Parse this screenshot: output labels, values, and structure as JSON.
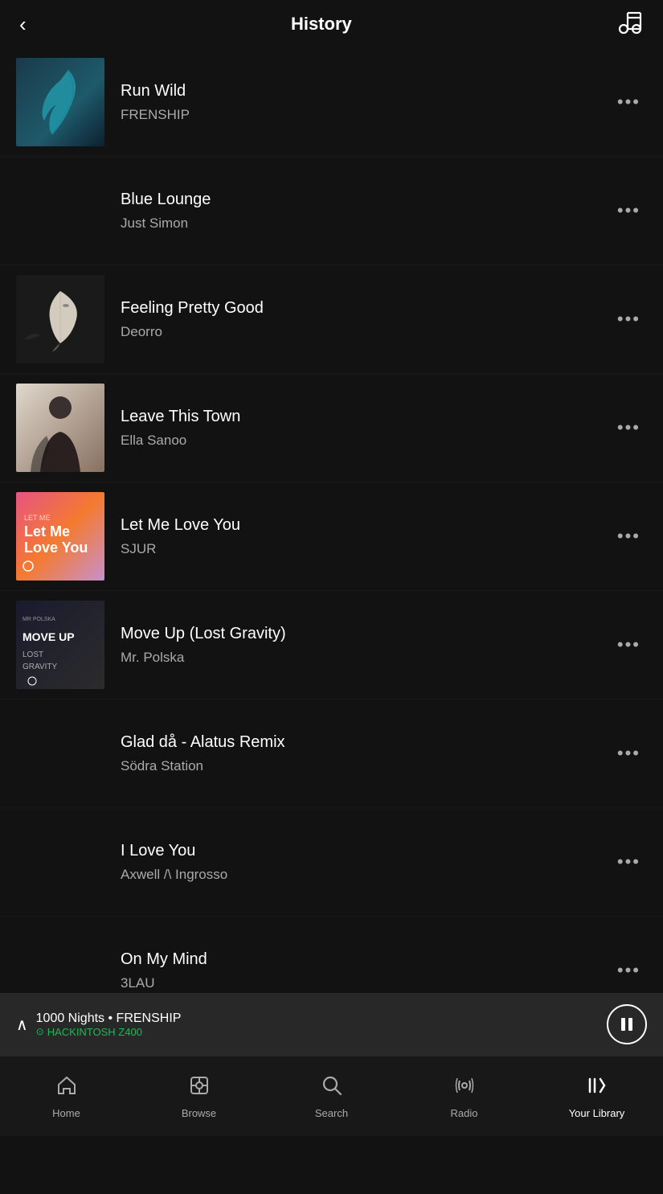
{
  "header": {
    "back_label": "‹",
    "title": "History",
    "music_icon": "♩"
  },
  "tracks": [
    {
      "id": "run-wild",
      "name": "Run Wild",
      "artist": "FRENSHIP",
      "art_class": "art-run-wild",
      "art_type": "feather"
    },
    {
      "id": "blue-lounge",
      "name": "Blue Lounge",
      "artist": "Just Simon",
      "art_class": "art-blue-lounge",
      "art_type": "gradient"
    },
    {
      "id": "feeling-pretty-good",
      "name": "Feeling Pretty Good",
      "artist": "Deorro",
      "art_class": "art-feeling-pretty-good",
      "art_type": "bird"
    },
    {
      "id": "leave-this-town",
      "name": "Leave This Town",
      "artist": "Ella Sanoo",
      "art_class": "art-leave-this-town",
      "art_type": "person"
    },
    {
      "id": "let-me-love-you",
      "name": "Let Me Love You",
      "artist": "SJUR",
      "art_class": "art-let-me-love-you",
      "art_type": "text-art"
    },
    {
      "id": "move-up",
      "name": "Move Up (Lost Gravity)",
      "artist": "Mr. Polska",
      "art_class": "art-move-up",
      "art_type": "text-art2"
    },
    {
      "id": "glad-da",
      "name": "Glad då - Alatus Remix",
      "artist": "Södra Station",
      "art_class": "art-glad-da",
      "art_type": "gradient"
    },
    {
      "id": "i-love-you",
      "name": "I Love You",
      "artist": "Axwell /\\ Ingrosso",
      "art_class": "art-i-love-you",
      "art_type": "gradient"
    },
    {
      "id": "on-my-mind",
      "name": "On My Mind",
      "artist": "3LAU",
      "art_class": "art-on-my-mind",
      "art_type": "gradient"
    }
  ],
  "now_playing": {
    "track": "1000 Nights",
    "separator": "•",
    "artist": "FRENSHIP",
    "device_label": "HACKINTOSH Z400",
    "chevron": "∧"
  },
  "bottom_nav": {
    "items": [
      {
        "id": "home",
        "label": "Home",
        "icon": "home"
      },
      {
        "id": "browse",
        "label": "Browse",
        "icon": "browse"
      },
      {
        "id": "search",
        "label": "Search",
        "icon": "search"
      },
      {
        "id": "radio",
        "label": "Radio",
        "icon": "radio"
      },
      {
        "id": "your-library",
        "label": "Your Library",
        "icon": "library",
        "active": true
      }
    ]
  }
}
